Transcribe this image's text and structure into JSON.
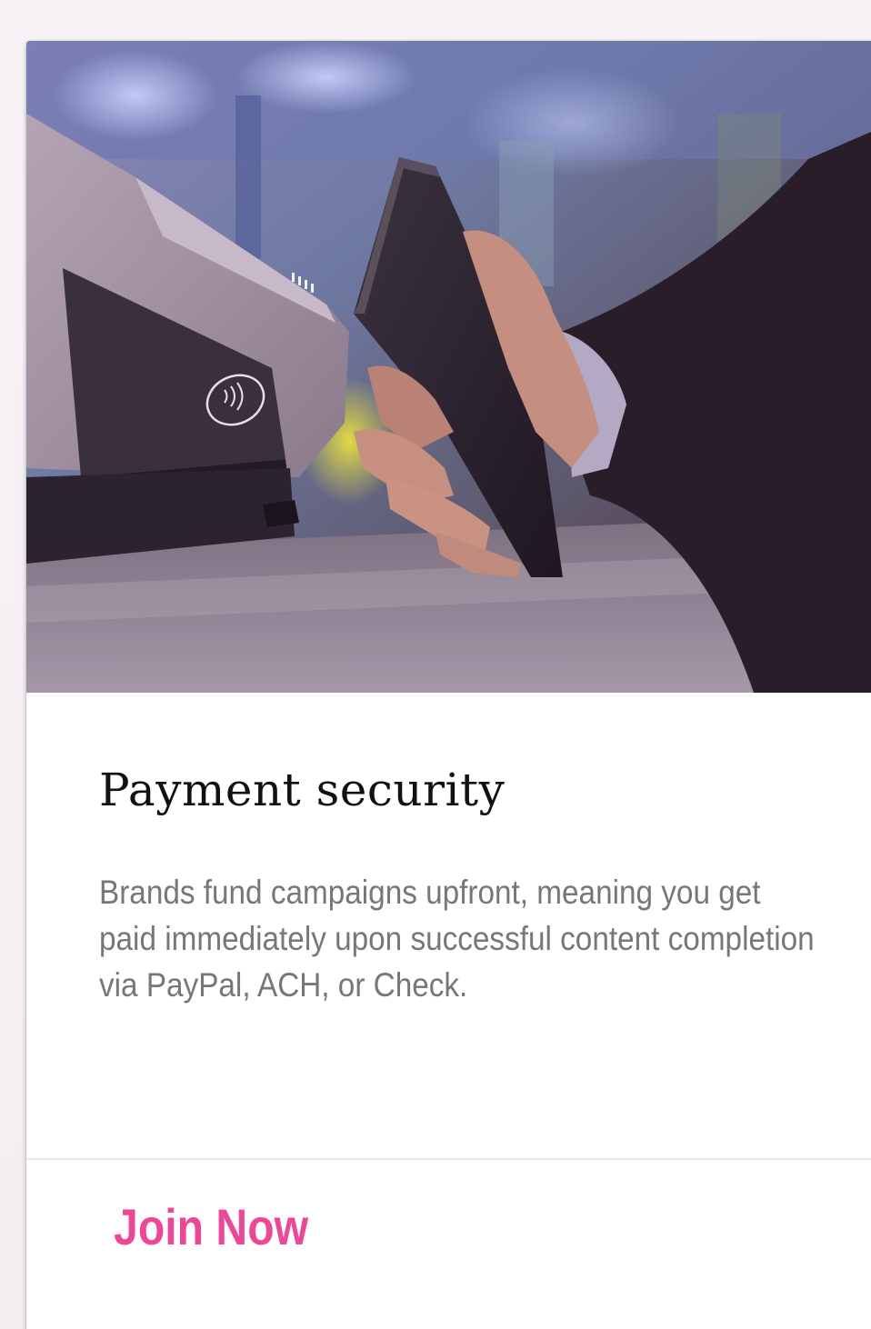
{
  "card": {
    "image": {
      "subject": "hand-tapping-phone-on-contactless-terminal",
      "icon": "contactless-payment-icon"
    },
    "title": "Payment security",
    "description": "Brands fund campaigns upfront, meaning you get paid immediately upon successful content completion via PayPal, ACH, or Check.",
    "action_label": "Join Now"
  },
  "colors": {
    "accent": "#ec4898",
    "title": "#111111",
    "body_text": "#777777",
    "divider": "#e8e8e8"
  }
}
